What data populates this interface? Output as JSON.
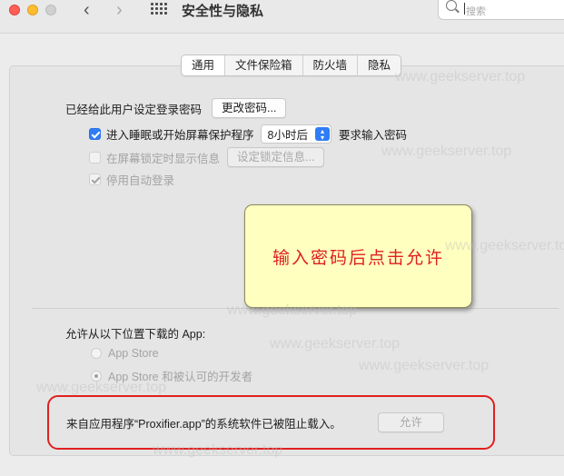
{
  "window": {
    "title": "安全性与隐私",
    "search_placeholder": "搜索"
  },
  "tabs": [
    {
      "label": "通用",
      "active": true
    },
    {
      "label": "文件保险箱",
      "active": false
    },
    {
      "label": "防火墙",
      "active": false
    },
    {
      "label": "隐私",
      "active": false
    }
  ],
  "general": {
    "password_set_text": "已经给此用户设定登录密码",
    "change_password_button": "更改密码...",
    "require_password": {
      "checked": true,
      "label_before": "进入睡眠或开始屏幕保护程序",
      "delay_value": "8小时后",
      "label_after": "要求输入密码"
    },
    "show_message": {
      "checked": false,
      "label": "在屏幕锁定时显示信息",
      "button": "设定锁定信息..."
    },
    "disable_autologin": {
      "checked": true,
      "label": "停用自动登录"
    }
  },
  "downloads": {
    "heading": "允许从以下位置下载的 App:",
    "options": [
      {
        "label": "App Store",
        "selected": false
      },
      {
        "label": "App Store 和被认可的开发者",
        "selected": true
      }
    ],
    "blocked_message": "来自应用程序“Proxifier.app”的系统软件已被阻止载入。",
    "allow_button": "允许"
  },
  "annotation": {
    "note_text": "输入密码后点击允许",
    "highlight_color": "#e02020",
    "note_color": "#ffffc0"
  },
  "watermark": "www.geekserver.top"
}
